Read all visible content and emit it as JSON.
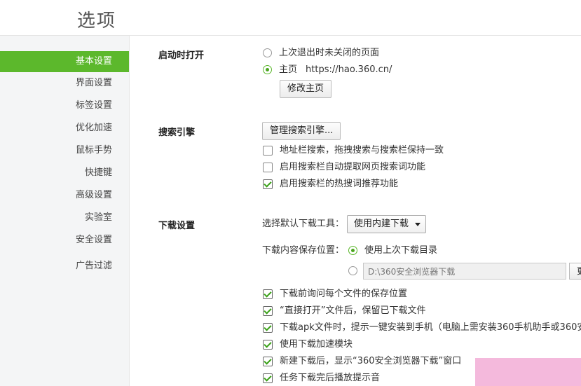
{
  "page": {
    "title": "选项"
  },
  "sidebar": {
    "items": [
      {
        "label": "基本设置",
        "active": true
      },
      {
        "label": "界面设置"
      },
      {
        "label": "标签设置"
      },
      {
        "label": "优化加速"
      },
      {
        "label": "鼠标手势"
      },
      {
        "label": "快捷键"
      },
      {
        "label": "高级设置"
      },
      {
        "label": "实验室"
      },
      {
        "label": "安全设置"
      },
      {
        "label": "广告过滤"
      }
    ]
  },
  "startup": {
    "title": "启动时打开",
    "option_last": "上次退出时未关闭的页面",
    "option_home": "主页",
    "home_url": "https://hao.360.cn/",
    "selected": "home",
    "change_home_button": "修改主页"
  },
  "search": {
    "title": "搜索引擎",
    "manage_button": "管理搜索引擎...",
    "options": [
      {
        "label": "地址栏搜索，拖拽搜索与搜索栏保持一致",
        "checked": false
      },
      {
        "label": "启用搜索栏自动提取网页搜索词功能",
        "checked": false
      },
      {
        "label": "启用搜索栏的热搜词推荐功能",
        "checked": true
      }
    ]
  },
  "download": {
    "title": "下载设置",
    "tool_label": "选择默认下载工具：",
    "tool_selected": "使用内建下载",
    "save_location_label": "下载内容保存位置：",
    "use_last_dir": "使用上次下载目录",
    "custom_path": "D:\\360安全浏览器下载",
    "browse_button": "更",
    "options": [
      {
        "label": "下载前询问每个文件的保存位置",
        "checked": true
      },
      {
        "label": "“直接打开”文件后，保留已下载文件",
        "checked": true
      },
      {
        "label": "下载apk文件时，提示一键安装到手机（电脑上需安装360手机助手或360安",
        "checked": true
      },
      {
        "label": "使用下载加速模块",
        "checked": true
      },
      {
        "label": "新建下载后，显示“360安全浏览器下载”窗口",
        "checked": true
      },
      {
        "label": "任务下载完后播放提示音",
        "checked": true
      }
    ]
  },
  "colors": {
    "accent": "#5cb82c",
    "sidebar_bg": "#f4f5f6",
    "watermark": "#f4b9dc"
  }
}
